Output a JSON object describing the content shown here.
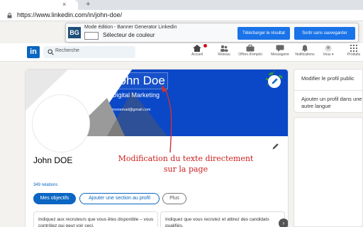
{
  "browser": {
    "tab_close": "×",
    "new_tab": "+",
    "url": "https://www.linkedin.com/in/john-doe/"
  },
  "extension": {
    "logo": "BG",
    "mode_label": "Mode édition - Banner Generator Linkedin",
    "color_label": "Sélecteur de couleur",
    "download_button": "Télécharger le résultat",
    "exit_button": "Sortir sans sauvegarder"
  },
  "nav": {
    "logo": "in",
    "search_placeholder": "Recherche",
    "items": [
      {
        "label": "Accueil",
        "icon": "home-icon"
      },
      {
        "label": "Réseau",
        "icon": "network-icon"
      },
      {
        "label": "Offres d'emploi",
        "icon": "jobs-icon"
      },
      {
        "label": "Messagerie",
        "icon": "messaging-icon"
      },
      {
        "label": "Notifications",
        "icon": "bell-icon"
      },
      {
        "label": "Vous ▾",
        "icon": "avatar-icon"
      },
      {
        "label": "Produits",
        "icon": "grid-icon"
      }
    ]
  },
  "banner": {
    "name": "John Doe",
    "title": "Digital Marketing",
    "email": "monemail@gmail.com",
    "colors": {
      "blue": "#0a48c8",
      "gray": "#9a9a9a",
      "dark": "#5a5a5a"
    }
  },
  "profile": {
    "name": "John DOE",
    "relations": "349 relations",
    "primary_button": "Mes objectifs",
    "add_section_button": "Ajouter une section au profil",
    "more_button": "Plus",
    "hint_1": "Indiquez aux recruteurs que vous êtes disponible – vous contrôlez qui peut voir ceci.",
    "hint_2": "Indiquez que vous recrutez et attirez des candidats qualifiés.",
    "next_arrow": "›"
  },
  "annotation": {
    "line1": "Modification du texte directement",
    "line2": "sur la page",
    "color": "#cc1f1f"
  },
  "sidebar": {
    "edit_profile_link": "Modifier le profil public",
    "add_language_link": "Ajouter un profil dans une autre langue"
  }
}
